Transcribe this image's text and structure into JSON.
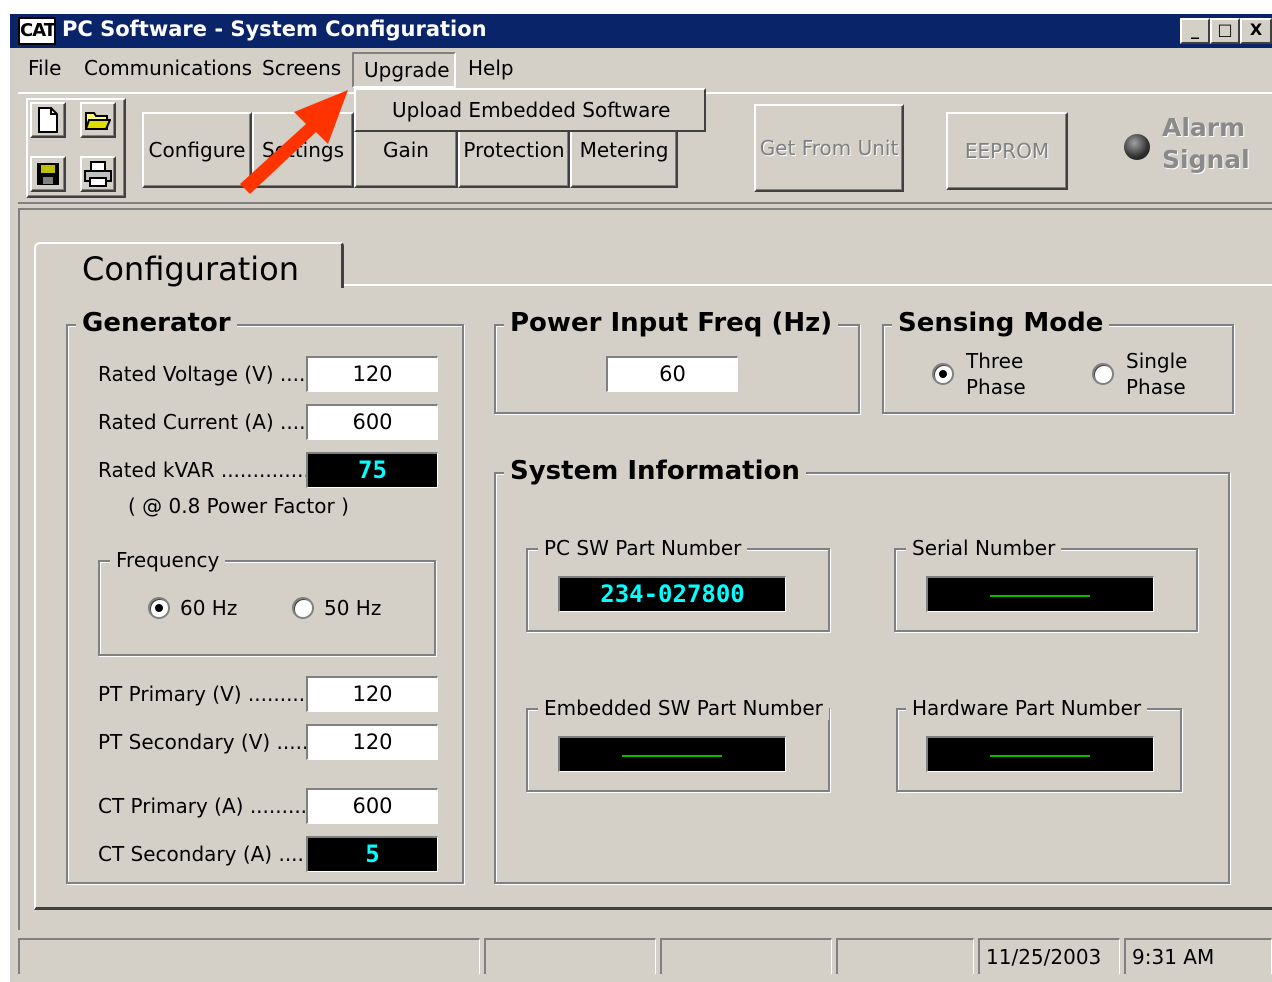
{
  "window": {
    "title": "PC Software - System Configuration",
    "logo_text": "CAT",
    "controls": {
      "minimize": "_",
      "maximize": "□",
      "close": "X"
    }
  },
  "menubar": {
    "file": "File",
    "communications": "Communications",
    "screens": "Screens",
    "upgrade": "Upgrade",
    "help": "Help"
  },
  "upgrade_menu": {
    "items": [
      "Upload Embedded Software"
    ]
  },
  "toolbar": {
    "icons": [
      "new-file-icon",
      "open-folder-icon",
      "save-disk-icon",
      "print-icon"
    ],
    "configure": "Configure",
    "settings": "Settings",
    "gain": "Gain",
    "protection": "Protection",
    "metering": "Metering",
    "get_from_unit": "Get From Unit",
    "eeprom": "EEPROM",
    "alarm_line1": "Alarm",
    "alarm_line2": "Signal"
  },
  "tab": {
    "label": "Configuration"
  },
  "generator": {
    "title": "Generator",
    "rated_voltage_label": "Rated Voltage (V) .....",
    "rated_voltage": "120",
    "rated_current_label": "Rated Current (A) ......",
    "rated_current": "600",
    "rated_kvar_label": "Rated kVAR ..............",
    "rated_kvar": "75",
    "power_factor_note": "( @ 0.8 Power Factor )",
    "frequency": {
      "title": "Frequency",
      "options": [
        "60 Hz",
        "50 Hz"
      ],
      "selected": "60 Hz"
    },
    "pt_primary_label": "PT Primary (V) ...........",
    "pt_primary": "120",
    "pt_secondary_label": "PT Secondary (V) .....",
    "pt_secondary": "120",
    "ct_primary_label": "CT Primary (A) ...........",
    "ct_primary": "600",
    "ct_secondary_label": "CT Secondary (A) .....",
    "ct_secondary": "5"
  },
  "power_input": {
    "title": "Power Input Freq (Hz)",
    "value": "60"
  },
  "sensing_mode": {
    "title": "Sensing Mode",
    "three_line1": "Three",
    "three_line2": "Phase",
    "single_line1": "Single",
    "single_line2": "Phase",
    "selected": "Three Phase"
  },
  "system_info": {
    "title": "System Information",
    "pc_sw_label": "PC SW Part Number",
    "pc_sw_value": "234-027800",
    "serial_label": "Serial Number",
    "embedded_label": "Embedded SW Part Number",
    "hardware_label": "Hardware Part Number"
  },
  "statusbar": {
    "date": "11/25/2003",
    "time": "9:31 AM"
  },
  "colors": {
    "titlebar": "#0a246a",
    "face": "#d4d0c8",
    "lcd_text": "#00ffff",
    "lcd_dash": "#00c000",
    "annotation_arrow": "#ff3300"
  }
}
